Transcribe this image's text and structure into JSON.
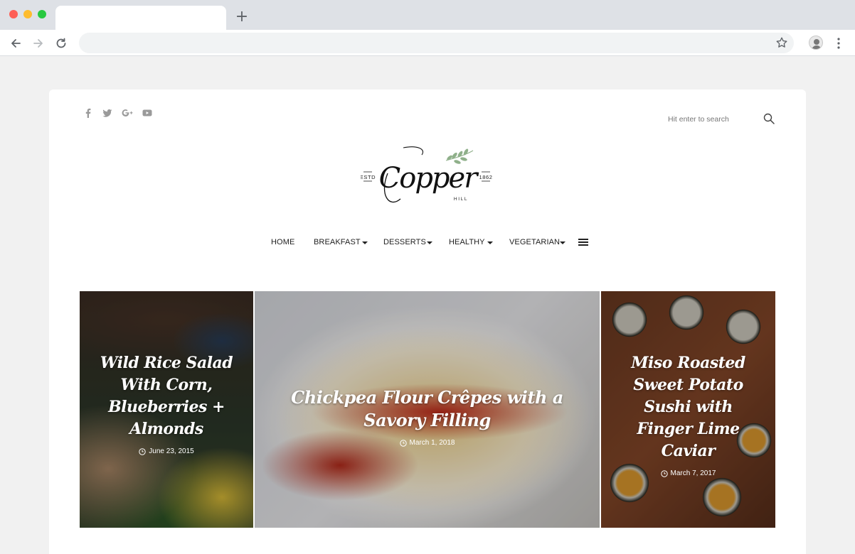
{
  "browser": {
    "new_tab_symbol": "+"
  },
  "header": {
    "social_icons": [
      "facebook-icon",
      "twitter-icon",
      "google-plus-icon",
      "youtube-icon"
    ],
    "search_placeholder": "Hit enter to search"
  },
  "logo": {
    "estd_label": "ESTD",
    "year": "1862",
    "script_text": "Copper",
    "sub_text": "HILL"
  },
  "menu": {
    "items": [
      {
        "label": "HOME",
        "dropdown": false
      },
      {
        "label": "BREAKFAST",
        "dropdown": true
      },
      {
        "label": "DESSERTS",
        "dropdown": true
      },
      {
        "label": "HEALTHY",
        "dropdown": true
      },
      {
        "label": "VEGETARIAN",
        "dropdown": true
      }
    ]
  },
  "slides": [
    {
      "title": "Wild Rice Salad With Corn, Blueberries + Almonds",
      "date": "June 23, 2015"
    },
    {
      "title": "Chickpea Flour Crêpes with a Savory Filling",
      "date": "March 1, 2018"
    },
    {
      "title": "Miso Roasted Sweet Potato Sushi with Finger Lime Caviar",
      "date": "March 7, 2017"
    }
  ],
  "colors": {
    "accent_leaf": "#8fb08a",
    "menu_text": "#222222",
    "card_bg": "#ffffff",
    "page_bg": "#f1f1f1"
  }
}
